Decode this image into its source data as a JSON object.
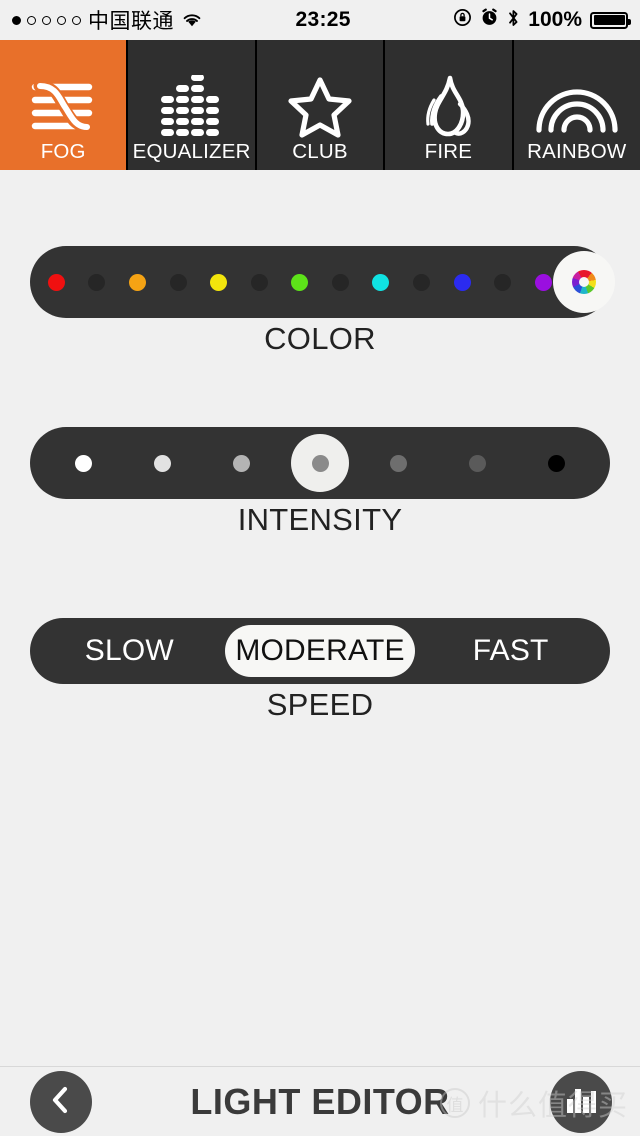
{
  "status_bar": {
    "signal_dots": [
      true,
      false,
      false,
      false,
      false
    ],
    "carrier": "中国联通",
    "wifi_icon": "wifi-icon",
    "time": "23:25",
    "rotation_lock_icon": "rotation-lock-icon",
    "alarm_icon": "alarm-clock-icon",
    "bluetooth_icon": "bluetooth-icon",
    "battery_percent": "100%",
    "battery_icon": "battery-full-icon"
  },
  "tabs": [
    {
      "label": "FOG",
      "icon": "fog-icon",
      "active": true
    },
    {
      "label": "EQUALIZER",
      "icon": "equalizer-icon",
      "active": false
    },
    {
      "label": "CLUB",
      "icon": "star-icon",
      "active": false
    },
    {
      "label": "FIRE",
      "icon": "flame-icon",
      "active": false
    },
    {
      "label": "RAINBOW",
      "icon": "rainbow-icon",
      "active": false
    }
  ],
  "theme": {
    "accent": "#E8702A",
    "tab_background": "#2F2F2F",
    "control_background": "#333333",
    "page_background": "#F0F0F0",
    "selected_pill": "#F7F7F5"
  },
  "color_control": {
    "label": "COLOR",
    "swatches": [
      {
        "name": "red",
        "color": "#F01010",
        "selected": false
      },
      {
        "name": "empty-1",
        "color": "#262626",
        "selected": false
      },
      {
        "name": "orange",
        "color": "#F5A314",
        "selected": false
      },
      {
        "name": "empty-2",
        "color": "#262626",
        "selected": false
      },
      {
        "name": "yellow",
        "color": "#F2E50C",
        "selected": false
      },
      {
        "name": "empty-3",
        "color": "#262626",
        "selected": false
      },
      {
        "name": "green",
        "color": "#5DE319",
        "selected": false
      },
      {
        "name": "empty-4",
        "color": "#262626",
        "selected": false
      },
      {
        "name": "cyan",
        "color": "#10E2E2",
        "selected": false
      },
      {
        "name": "empty-5",
        "color": "#262626",
        "selected": false
      },
      {
        "name": "blue",
        "color": "#2B2BF0",
        "selected": false
      },
      {
        "name": "empty-6",
        "color": "#262626",
        "selected": false
      },
      {
        "name": "purple",
        "color": "#9A0FE0",
        "selected": false
      },
      {
        "name": "multicolor",
        "color": "wheel",
        "selected": true
      }
    ]
  },
  "intensity_control": {
    "label": "INTENSITY",
    "steps": [
      {
        "name": "level-1",
        "color": "#FFFFFF",
        "selected": false
      },
      {
        "name": "level-2",
        "color": "#E2E2E2",
        "selected": false
      },
      {
        "name": "level-3",
        "color": "#B4B4B4",
        "selected": false
      },
      {
        "name": "level-4",
        "color": "#8A8A8A",
        "selected": true
      },
      {
        "name": "level-5",
        "color": "#6E6E6E",
        "selected": false
      },
      {
        "name": "level-6",
        "color": "#5A5A5A",
        "selected": false
      },
      {
        "name": "level-7",
        "color": "#000000",
        "selected": false
      }
    ]
  },
  "speed_control": {
    "label": "SPEED",
    "options": [
      {
        "label": "SLOW",
        "selected": false
      },
      {
        "label": "MODERATE",
        "selected": true
      },
      {
        "label": "FAST",
        "selected": false
      }
    ]
  },
  "bottom_bar": {
    "back_icon": "chevron-left-icon",
    "title": "LIGHT EDITOR",
    "action_icon": "equalizer-bars-icon"
  },
  "watermark": {
    "badge": "值",
    "text": "什么值得买"
  }
}
